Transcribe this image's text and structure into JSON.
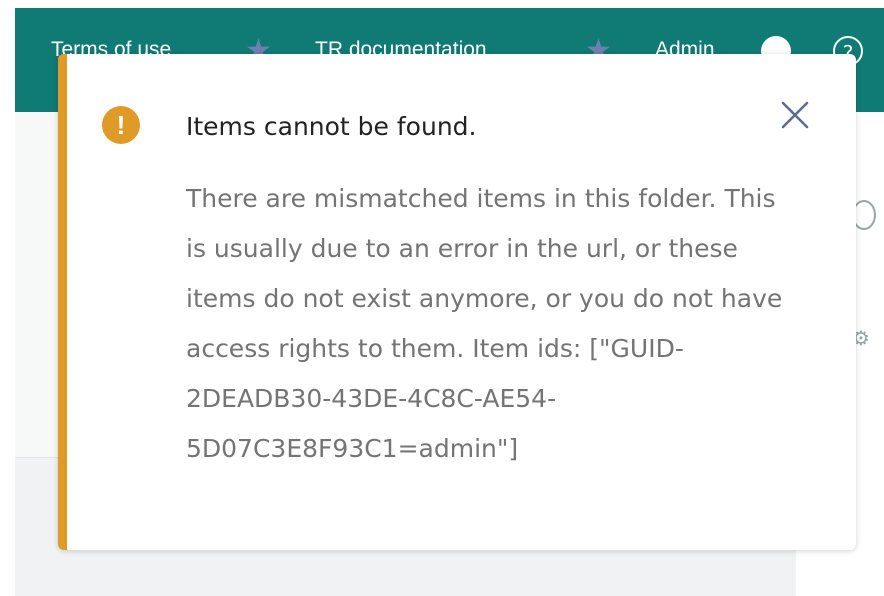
{
  "header": {
    "nav_links": [
      "Terms of use",
      "TR documentation",
      "Admin"
    ],
    "star_icon": "star-icon",
    "user_icon": "user-icon",
    "help_icon": "help-icon",
    "help_glyph": "?",
    "colors": {
      "header_bg": "#107a74"
    }
  },
  "notification": {
    "severity": "warning",
    "icon": "exclamation-circle-icon",
    "icon_glyph": "!",
    "title": "Items cannot be found.",
    "message": "There are mismatched items in this folder. This\nis usually due to an error in the url, or these\nitems do not exist anymore, or you do not have\naccess rights to them. Item ids: [\"GUID-\n2DEADB30-43DE-4C8C-AE54-\n5D07C3E8F93C1=admin\"]",
    "close_icon": "close-icon",
    "colors": {
      "accent": "#df9a27",
      "title_text": "#222222",
      "body_text": "#747474",
      "close": "#5a6b8c"
    }
  }
}
